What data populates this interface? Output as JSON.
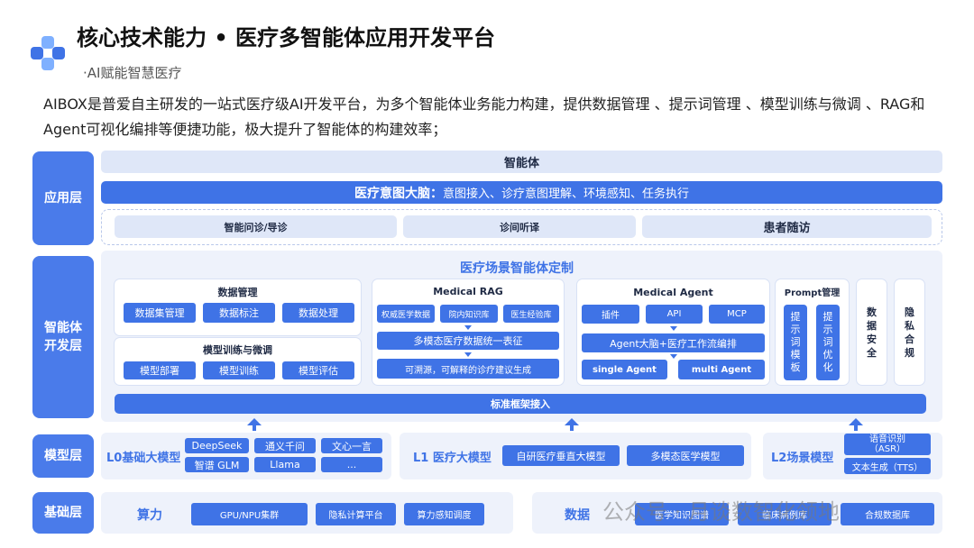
{
  "header": {
    "title": "核心技术能力 • 医疗多智能体应用开发平台",
    "subtitle": "·AI赋能智慧医疗"
  },
  "intro": "AIBOX是普爱自主研发的一站式医疗级AI开发平台，为多个智能体业务能力构建，提供数据管理 、提示词管理 、模型训练与微调 、RAG和Agent可视化编排等便捷功能，极大提升了智能体的构建效率；",
  "layers": {
    "app": "应用层",
    "dev": "智能体\n开发层",
    "model": "模型层",
    "base": "基础层"
  },
  "app": {
    "top": "智能体",
    "brain_title": "医疗意图大脑：",
    "brain_items": "意图接入、诊疗意图理解、环境感知、任务执行",
    "scenarios": [
      "智能问诊/导诊",
      "诊间听译",
      "患者随访"
    ]
  },
  "dev": {
    "title": "医疗场景智能体定制",
    "data_mgmt": {
      "title": "数据管理",
      "items": [
        "数据集管理",
        "数据标注",
        "数据处理"
      ]
    },
    "model_train": {
      "title": "模型训练与微调",
      "items": [
        "模型部署",
        "模型训练",
        "模型评估"
      ]
    },
    "rag": {
      "title": "Medical RAG",
      "items": [
        "权威医学数据",
        "院内知识库",
        "医生经验库"
      ],
      "unify": "多模态医疗数据统一表征",
      "output": "可溯源，可解释的诊疗建议生成"
    },
    "agent": {
      "title": "Medical Agent",
      "items": [
        "插件",
        "API",
        "MCP"
      ],
      "brain": "Agent大脑+医疗工作流编排",
      "single": "single Agent",
      "multi": "multi Agent"
    },
    "prompt": {
      "title": "Prompt管理",
      "items": [
        "提示词模板",
        "提示词优化"
      ]
    },
    "security": "数据安全",
    "privacy": "隐私合规",
    "framework": "标准框架接入"
  },
  "model": {
    "l0": {
      "label": "L0基础大模型",
      "items": [
        "DeepSeek",
        "通义千问",
        "文心一言",
        "智谱 GLM",
        "Llama",
        "..."
      ]
    },
    "l1": {
      "label": "L1 医疗大模型",
      "items": [
        "自研医疗垂直大模型",
        "多模态医学模型"
      ]
    },
    "l2": {
      "label": "L2场景模型",
      "items": [
        "语音识别\n（ASR）",
        "文本生成（TTS）"
      ]
    }
  },
  "base": {
    "compute": {
      "label": "算力",
      "items": [
        "GPU/NPU集群",
        "隐私计算平台",
        "算力感知调度"
      ]
    },
    "data": {
      "label": "数据",
      "items": [
        "医学知识图谱",
        "临床病例库",
        "合规数据库"
      ]
    }
  },
  "watermark": "公众号 · 月谈数智化领地",
  "colors": {
    "primary": "#3f73e6",
    "label": "#4a7bea",
    "panel": "#eef2fb"
  }
}
